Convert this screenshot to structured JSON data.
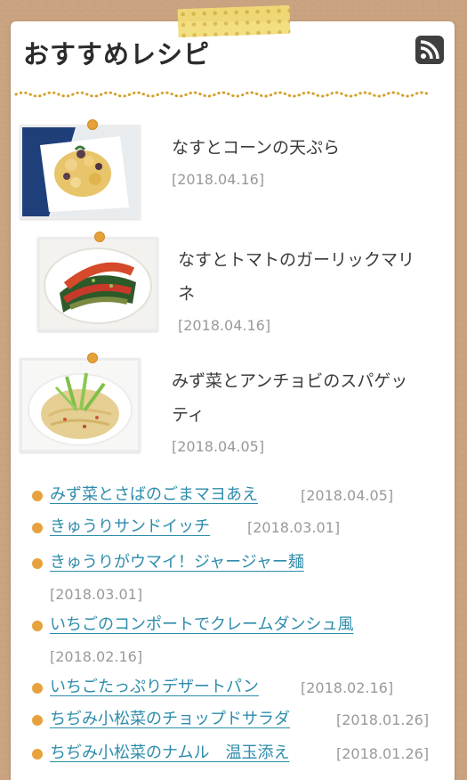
{
  "widget": {
    "title": "おすすめレシピ",
    "rss_icon": "rss-icon"
  },
  "featured": [
    {
      "title": "なすとコーンの天ぷら",
      "date": "[2018.04.16]",
      "image": "eggplant-corn-tempura-photo"
    },
    {
      "title_line1": "なすとトマトのガーリックマリ",
      "title_line2": "ネ",
      "date": "[2018.04.16]",
      "image": "eggplant-tomato-marinade-photo"
    },
    {
      "title_line1": "みず菜とアンチョビのスパゲッ",
      "title_line2": "ティ",
      "date": "[2018.04.05]",
      "image": "mizuna-anchovy-spaghetti-photo"
    }
  ],
  "list": [
    {
      "title": "みず菜とさばのごまマヨあえ",
      "date": "[2018.04.05]"
    },
    {
      "title": "きゅうりサンドイッチ",
      "date": "[2018.03.01]"
    },
    {
      "title": "きゅうりがウマイ！ジャージャー麺",
      "date": "[2018.03.01]"
    },
    {
      "title": "いちごのコンポートでクレームダンシュ風",
      "date": "[2018.02.16]"
    },
    {
      "title": "いちごたっぷりデザートパン",
      "date": "[2018.02.16]"
    },
    {
      "title": "ちぢみ小松菜のチョップドサラダ",
      "date": "[2018.01.26]"
    },
    {
      "title": "ちぢみ小松菜のナムル　温玉添え",
      "date": "[2018.01.26]"
    }
  ],
  "colors": {
    "background": "#c9a37f",
    "accent": "#e6a23c",
    "link": "#2e8cab",
    "tape": "#f3dc76"
  }
}
